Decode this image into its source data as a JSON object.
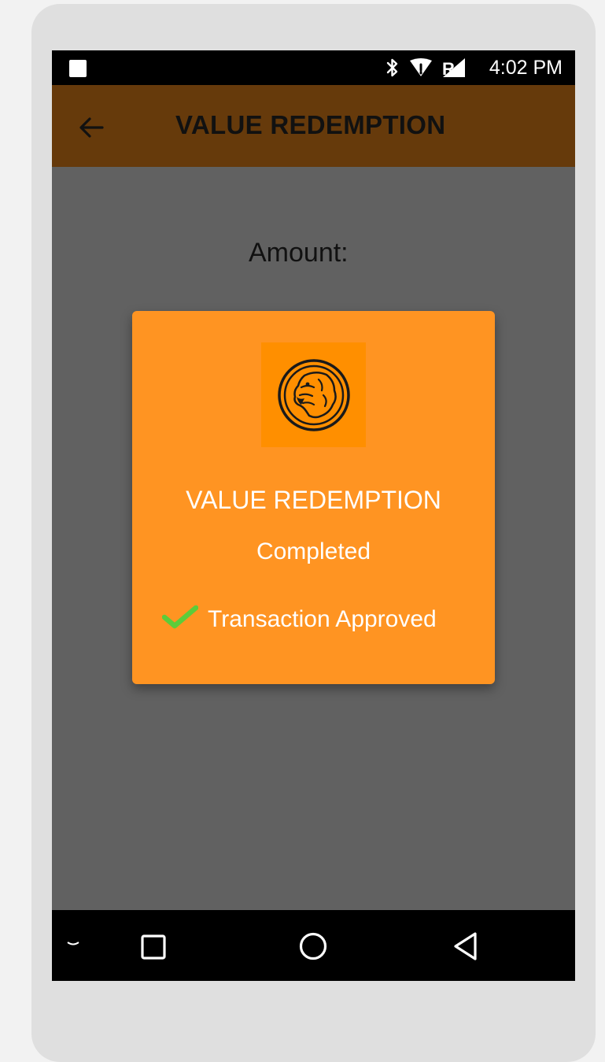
{
  "status_bar": {
    "time": "4:02 PM",
    "icons": [
      "notification-square-icon",
      "bluetooth-icon",
      "wifi-icon",
      "signal-icon"
    ]
  },
  "app_bar": {
    "title": "VALUE REDEMPTION",
    "back_icon": "back-arrow-icon"
  },
  "content": {
    "amount_label": "Amount:"
  },
  "dialog": {
    "logo": "tiger-logo",
    "title": "VALUE REDEMPTION",
    "status": "Completed",
    "result": "Transaction Approved",
    "result_icon": "checkmark-icon"
  },
  "nav_bar": {
    "icons": [
      "chevron-down-icon",
      "recents-square-icon",
      "home-circle-icon",
      "back-triangle-icon"
    ]
  },
  "colors": {
    "app_bar": "#663a0b",
    "screen_bg": "#616161",
    "dialog_bg": "#ff9422",
    "logo_bg": "#ff8f00",
    "check": "#5ccc3a"
  }
}
